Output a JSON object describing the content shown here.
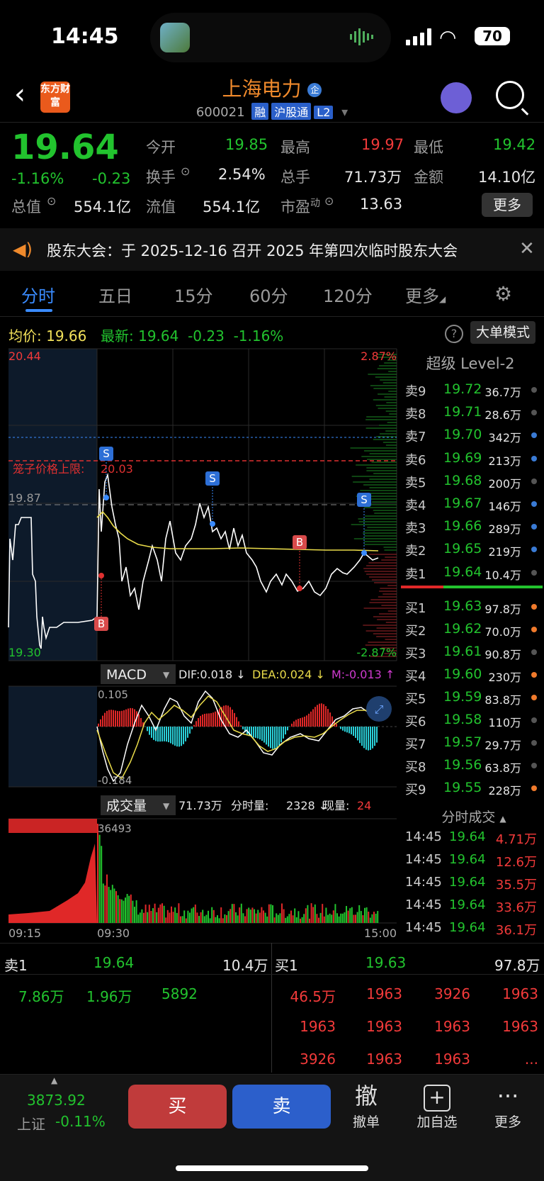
{
  "status_bar": {
    "time": "14:45",
    "battery": "70"
  },
  "header": {
    "logo_text": "东方财富",
    "stock_name": "上海电力",
    "stock_code": "600021",
    "tags": [
      "融",
      "沪股通",
      "L2"
    ]
  },
  "quote": {
    "price": "19.64",
    "change_pct": "-1.16%",
    "change": "-0.23",
    "open_label": "今开",
    "open": "19.85",
    "high_label": "最高",
    "high": "19.97",
    "low_label": "最低",
    "low": "19.42",
    "turnover_label": "换手",
    "turnover": "2.54%",
    "volume_label": "总手",
    "volume": "71.73万",
    "amount_label": "金额",
    "amount": "14.10亿",
    "mktcap_label": "总值",
    "mktcap": "554.1亿",
    "float_label": "流值",
    "float": "554.1亿",
    "pe_label": "市盈",
    "pe_sup": "动",
    "pe": "13.63",
    "more_label": "更多"
  },
  "notice": {
    "text": "股东大会：于 2025-12-16 召开 2025 年第四次临时股东大会"
  },
  "tabs": [
    {
      "label": "分时"
    },
    {
      "label": "五日"
    },
    {
      "label": "15分"
    },
    {
      "label": "60分"
    },
    {
      "label": "120分"
    },
    {
      "label": "更多"
    }
  ],
  "info_row": {
    "avg_label": "均价:",
    "avg": "19.66",
    "latest_label": "最新:",
    "latest": "19.64",
    "latest_change": "-0.23",
    "latest_pct": "-1.16%",
    "help": "?",
    "big_order_mode": "大单模式"
  },
  "chart_labels": {
    "y_top": "20.44",
    "y_bottom": "19.30",
    "y_ref": "19.87",
    "pct_top": "2.87%",
    "pct_bottom": "-2.87%",
    "cage_label": "笼子价格上限:",
    "cage_value": "20.03",
    "macd_select": "MACD",
    "dif": "DIF:0.018 ↓",
    "dea": "DEA:0.024 ↓",
    "m": "M:-0.013 ↑",
    "macd_top": "0.105",
    "macd_bottom": "-0.184",
    "vol_select": "成交量",
    "vol_total": "71.73万",
    "vol_min_label": "分时量:",
    "vol_min": "2328 ↓",
    "vol_now_label": "现量:",
    "vol_now": "24",
    "vol_max": "36493",
    "t_start": "09:15",
    "t_mid": "09:30",
    "t_end": "15:00",
    "marker_s": "S",
    "marker_b": "B"
  },
  "level2": {
    "title": "超级 Level-2",
    "asks": [
      {
        "label": "卖9",
        "price": "19.72",
        "vol": "36.7万",
        "dot": "#555555"
      },
      {
        "label": "卖8",
        "price": "19.71",
        "vol": "28.6万",
        "dot": "#555555"
      },
      {
        "label": "卖7",
        "price": "19.70",
        "vol": "342万",
        "dot": "#3a7bd5"
      },
      {
        "label": "卖6",
        "price": "19.69",
        "vol": "213万",
        "dot": "#3a7bd5"
      },
      {
        "label": "卖5",
        "price": "19.68",
        "vol": "200万",
        "dot": "#555555"
      },
      {
        "label": "卖4",
        "price": "19.67",
        "vol": "146万",
        "dot": "#3a7bd5"
      },
      {
        "label": "卖3",
        "price": "19.66",
        "vol": "289万",
        "dot": "#3a7bd5"
      },
      {
        "label": "卖2",
        "price": "19.65",
        "vol": "219万",
        "dot": "#3a7bd5"
      },
      {
        "label": "卖1",
        "price": "19.64",
        "vol": "10.4万",
        "dot": "#555555"
      }
    ],
    "bids": [
      {
        "label": "买1",
        "price": "19.63",
        "vol": "97.8万",
        "dot": "#f07a2c"
      },
      {
        "label": "买2",
        "price": "19.62",
        "vol": "70.0万",
        "dot": "#f07a2c"
      },
      {
        "label": "买3",
        "price": "19.61",
        "vol": "90.8万",
        "dot": "#555555"
      },
      {
        "label": "买4",
        "price": "19.60",
        "vol": "230万",
        "dot": "#f07a2c"
      },
      {
        "label": "买5",
        "price": "19.59",
        "vol": "83.8万",
        "dot": "#f07a2c"
      },
      {
        "label": "买6",
        "price": "19.58",
        "vol": "110万",
        "dot": "#555555"
      },
      {
        "label": "买7",
        "price": "19.57",
        "vol": "29.7万",
        "dot": "#555555"
      },
      {
        "label": "买8",
        "price": "19.56",
        "vol": "63.8万",
        "dot": "#555555"
      },
      {
        "label": "买9",
        "price": "19.55",
        "vol": "228万",
        "dot": "#f07a2c"
      }
    ]
  },
  "ticks": {
    "title": "分时成交",
    "rows": [
      {
        "time": "14:45",
        "price": "19.64",
        "vol": "4.71万"
      },
      {
        "time": "14:45",
        "price": "19.64",
        "vol": "12.6万"
      },
      {
        "time": "14:45",
        "price": "19.64",
        "vol": "35.5万"
      },
      {
        "time": "14:45",
        "price": "19.64",
        "vol": "33.6万"
      },
      {
        "time": "14:45",
        "price": "19.64",
        "vol": "36.1万"
      }
    ]
  },
  "book": {
    "ask_label": "卖1",
    "ask_price": "19.64",
    "ask_vol": "10.4万",
    "bid_label": "买1",
    "bid_price": "19.63",
    "bid_vol": "97.8万",
    "ask_orders": [
      "7.86万",
      "1.96万",
      "5892"
    ],
    "bid_orders": [
      "46.5万",
      "1963",
      "3926",
      "1963",
      "1963",
      "1963",
      "1963",
      "1963",
      "3926",
      "1963",
      "1963",
      "..."
    ]
  },
  "footer": {
    "index_value": "3873.92",
    "index_name": "上证",
    "index_change": "-0.11%",
    "buy": "买",
    "sell": "卖",
    "cancel_icon": "撤",
    "cancel": "撤单",
    "add_watch_icon": "+",
    "add_watch": "加自选",
    "more": "更多"
  }
}
